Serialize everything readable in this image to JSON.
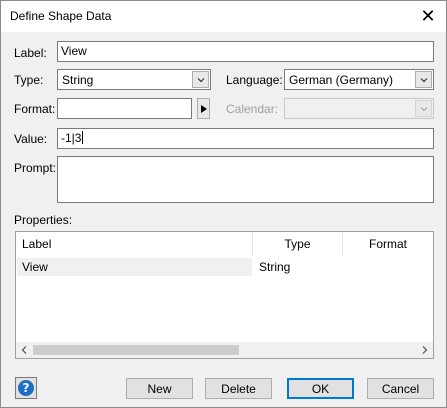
{
  "window": {
    "title": "Define Shape Data"
  },
  "fields": {
    "label_caption": "Label:",
    "label_value": "View",
    "type_caption": "Type:",
    "type_value": "String",
    "language_caption": "Language:",
    "language_value": "German (Germany)",
    "format_caption": "Format:",
    "format_value": "",
    "calendar_caption": "Calendar:",
    "calendar_value": "",
    "value_caption": "Value:",
    "value_value": "-1|3",
    "prompt_caption": "Prompt:",
    "prompt_value": ""
  },
  "properties": {
    "caption": "Properties:",
    "columns": [
      "Label",
      "Type",
      "Format"
    ],
    "rows": [
      {
        "label": "View",
        "type": "String",
        "format": ""
      }
    ]
  },
  "buttons": {
    "new": "New",
    "delete": "Delete",
    "ok": "OK",
    "cancel": "Cancel"
  },
  "icons": {
    "close": "close-icon",
    "help": "help-icon",
    "dropdown": "chevron-down-icon",
    "format_picker": "triangle-right-icon",
    "scroll_left": "chevron-left-icon",
    "scroll_right": "chevron-right-icon"
  },
  "colors": {
    "default_button_border": "#0078d7",
    "help_icon": "#1d6fc4",
    "dialog_background": "#f0f0f0"
  },
  "help_glyph": "?",
  "close_glyph": "✕"
}
